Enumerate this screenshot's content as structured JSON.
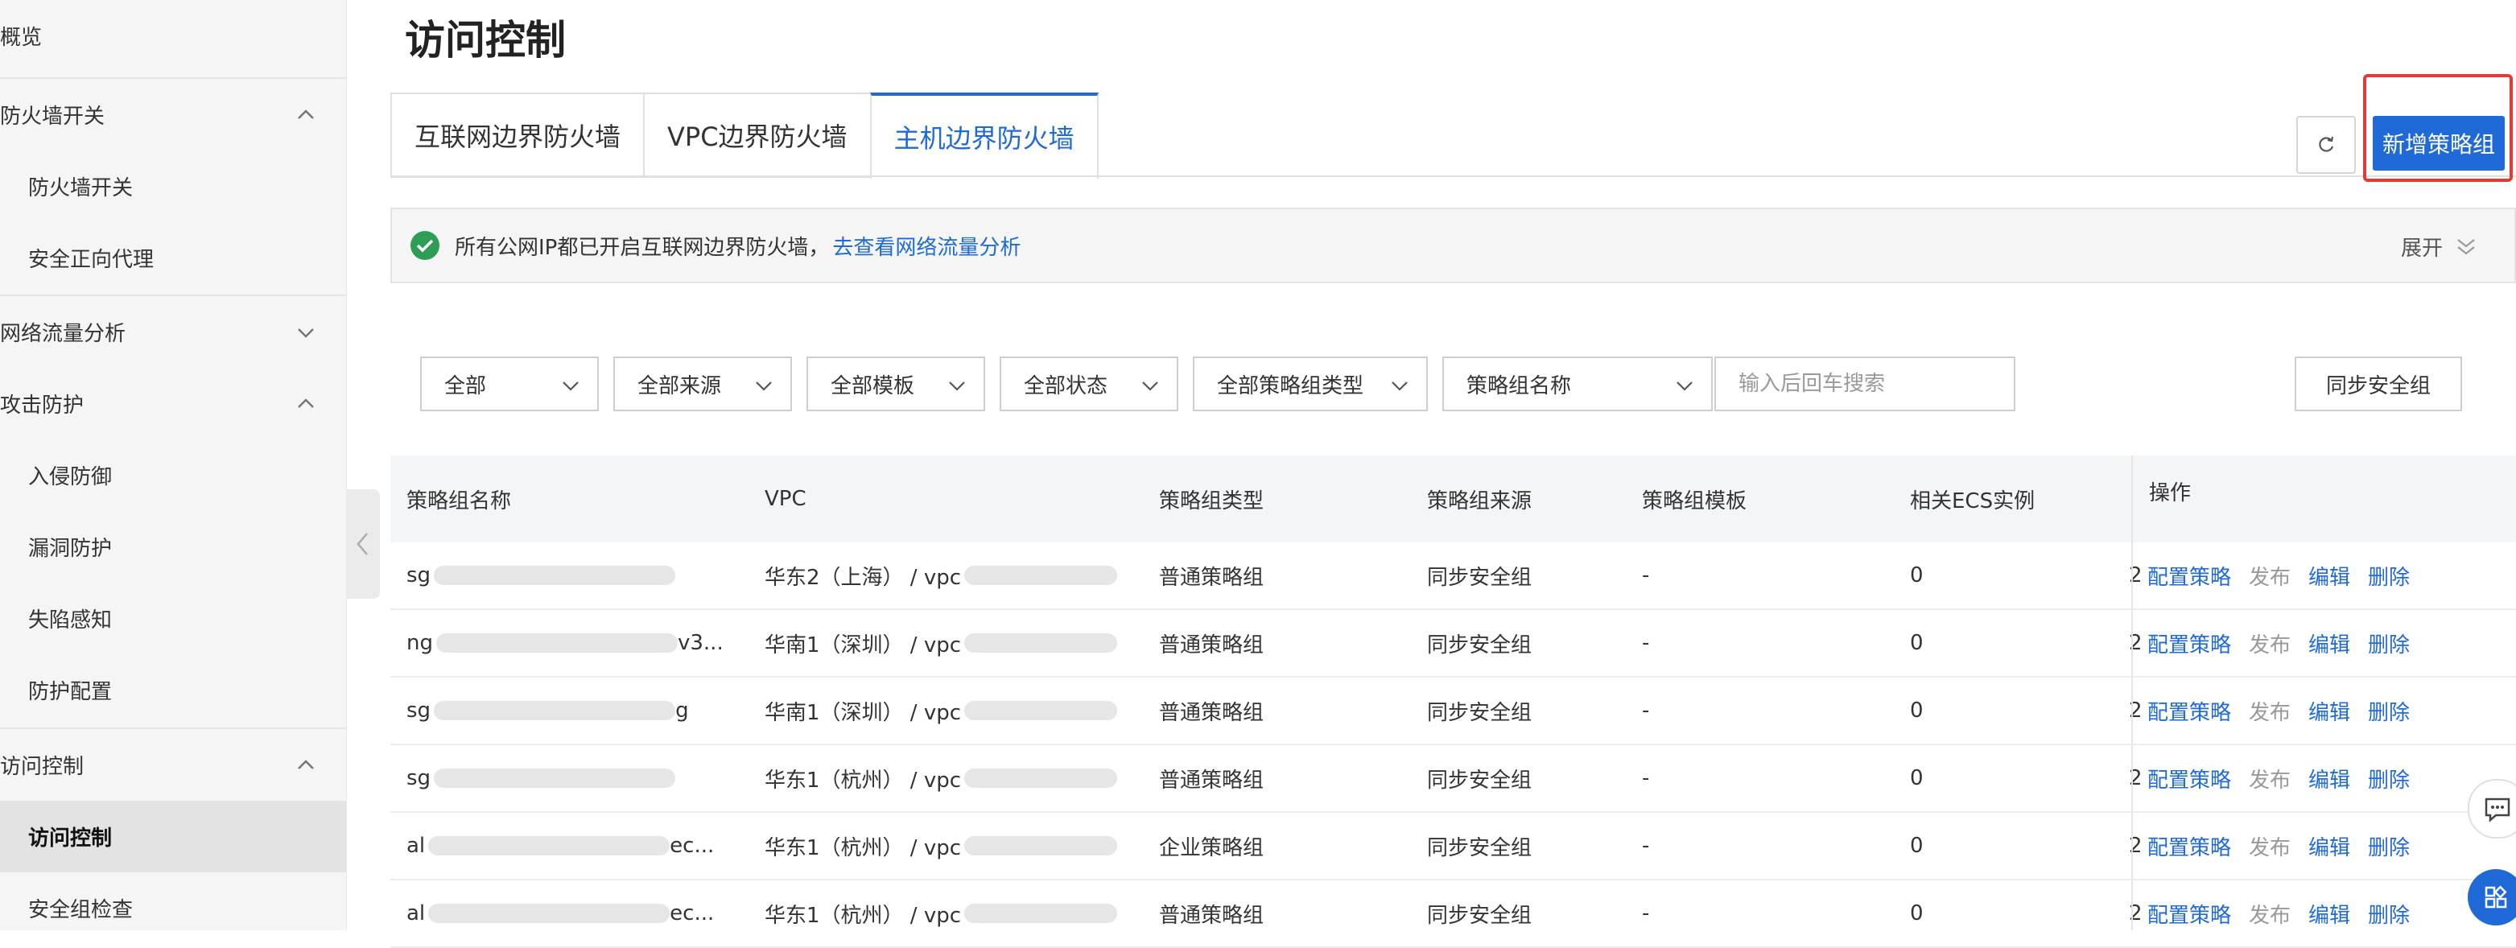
{
  "sidebar": {
    "items": [
      {
        "label": "概览"
      },
      {
        "label": "防火墙开关"
      },
      {
        "label": "防火墙开关"
      },
      {
        "label": "安全正向代理"
      },
      {
        "label": "网络流量分析"
      },
      {
        "label": "攻击防护"
      },
      {
        "label": "入侵防御"
      },
      {
        "label": "漏洞防护"
      },
      {
        "label": "失陷感知"
      },
      {
        "label": "防护配置"
      },
      {
        "label": "访问控制"
      },
      {
        "label": "访问控制"
      },
      {
        "label": "安全组检查"
      }
    ]
  },
  "page": {
    "title": "访问控制"
  },
  "tabs": [
    {
      "label": "互联网边界防火墙"
    },
    {
      "label": "VPC边界防火墙"
    },
    {
      "label": "主机边界防火墙"
    }
  ],
  "toolbar": {
    "add_label": "新增策略组"
  },
  "notice": {
    "text": "所有公网IP都已开启互联网边界防火墙，",
    "link": "去查看网络流量分析",
    "expand": "展开"
  },
  "filters": [
    {
      "label": "全部"
    },
    {
      "label": "全部来源"
    },
    {
      "label": "全部模板"
    },
    {
      "label": "全部状态"
    },
    {
      "label": "全部策略组类型"
    },
    {
      "label": "策略组名称"
    }
  ],
  "search": {
    "placeholder": "输入后回车搜索"
  },
  "sync": {
    "label": "同步安全组"
  },
  "table": {
    "headers": [
      "策略组名称",
      "VPC",
      "策略组类型",
      "策略组来源",
      "策略组模板",
      "相关ECS实例",
      "操作"
    ],
    "rows": [
      {
        "name": "sg",
        "vpc": "华东2（上海） / vpc",
        "type": "普通策略组",
        "source": "同步安全组",
        "template": "-",
        "ecs": "0",
        "extra": "2"
      },
      {
        "name": "ng",
        "name_suffix": "v3...",
        "vpc": "华南1（深圳） / vpc",
        "type": "普通策略组",
        "source": "同步安全组",
        "template": "-",
        "ecs": "0",
        "extra": "2"
      },
      {
        "name": "sg",
        "name_suffix": "g",
        "vpc": "华南1（深圳） / vpc",
        "type": "普通策略组",
        "source": "同步安全组",
        "template": "-",
        "ecs": "0",
        "extra": "2"
      },
      {
        "name": "sg",
        "vpc": "华东1（杭州） / vpc",
        "type": "普通策略组",
        "source": "同步安全组",
        "template": "-",
        "ecs": "0",
        "extra": "2"
      },
      {
        "name": "al",
        "name_suffix": "ec...",
        "vpc": "华东1（杭州） / vpc",
        "type": "企业策略组",
        "source": "同步安全组",
        "template": "-",
        "ecs": "0",
        "extra": "2"
      },
      {
        "name": "al",
        "name_suffix": "ec...",
        "vpc": "华东1（杭州） / vpc",
        "type": "普通策略组",
        "source": "同步安全组",
        "template": "-",
        "ecs": "0",
        "extra": "2"
      }
    ],
    "ops": {
      "config": "配置策略",
      "publish": "发布",
      "edit": "编辑",
      "delete": "删除"
    }
  },
  "colors": {
    "accent": "#1f6ad6",
    "highlight": "#e53935",
    "success": "#2e9e57"
  }
}
